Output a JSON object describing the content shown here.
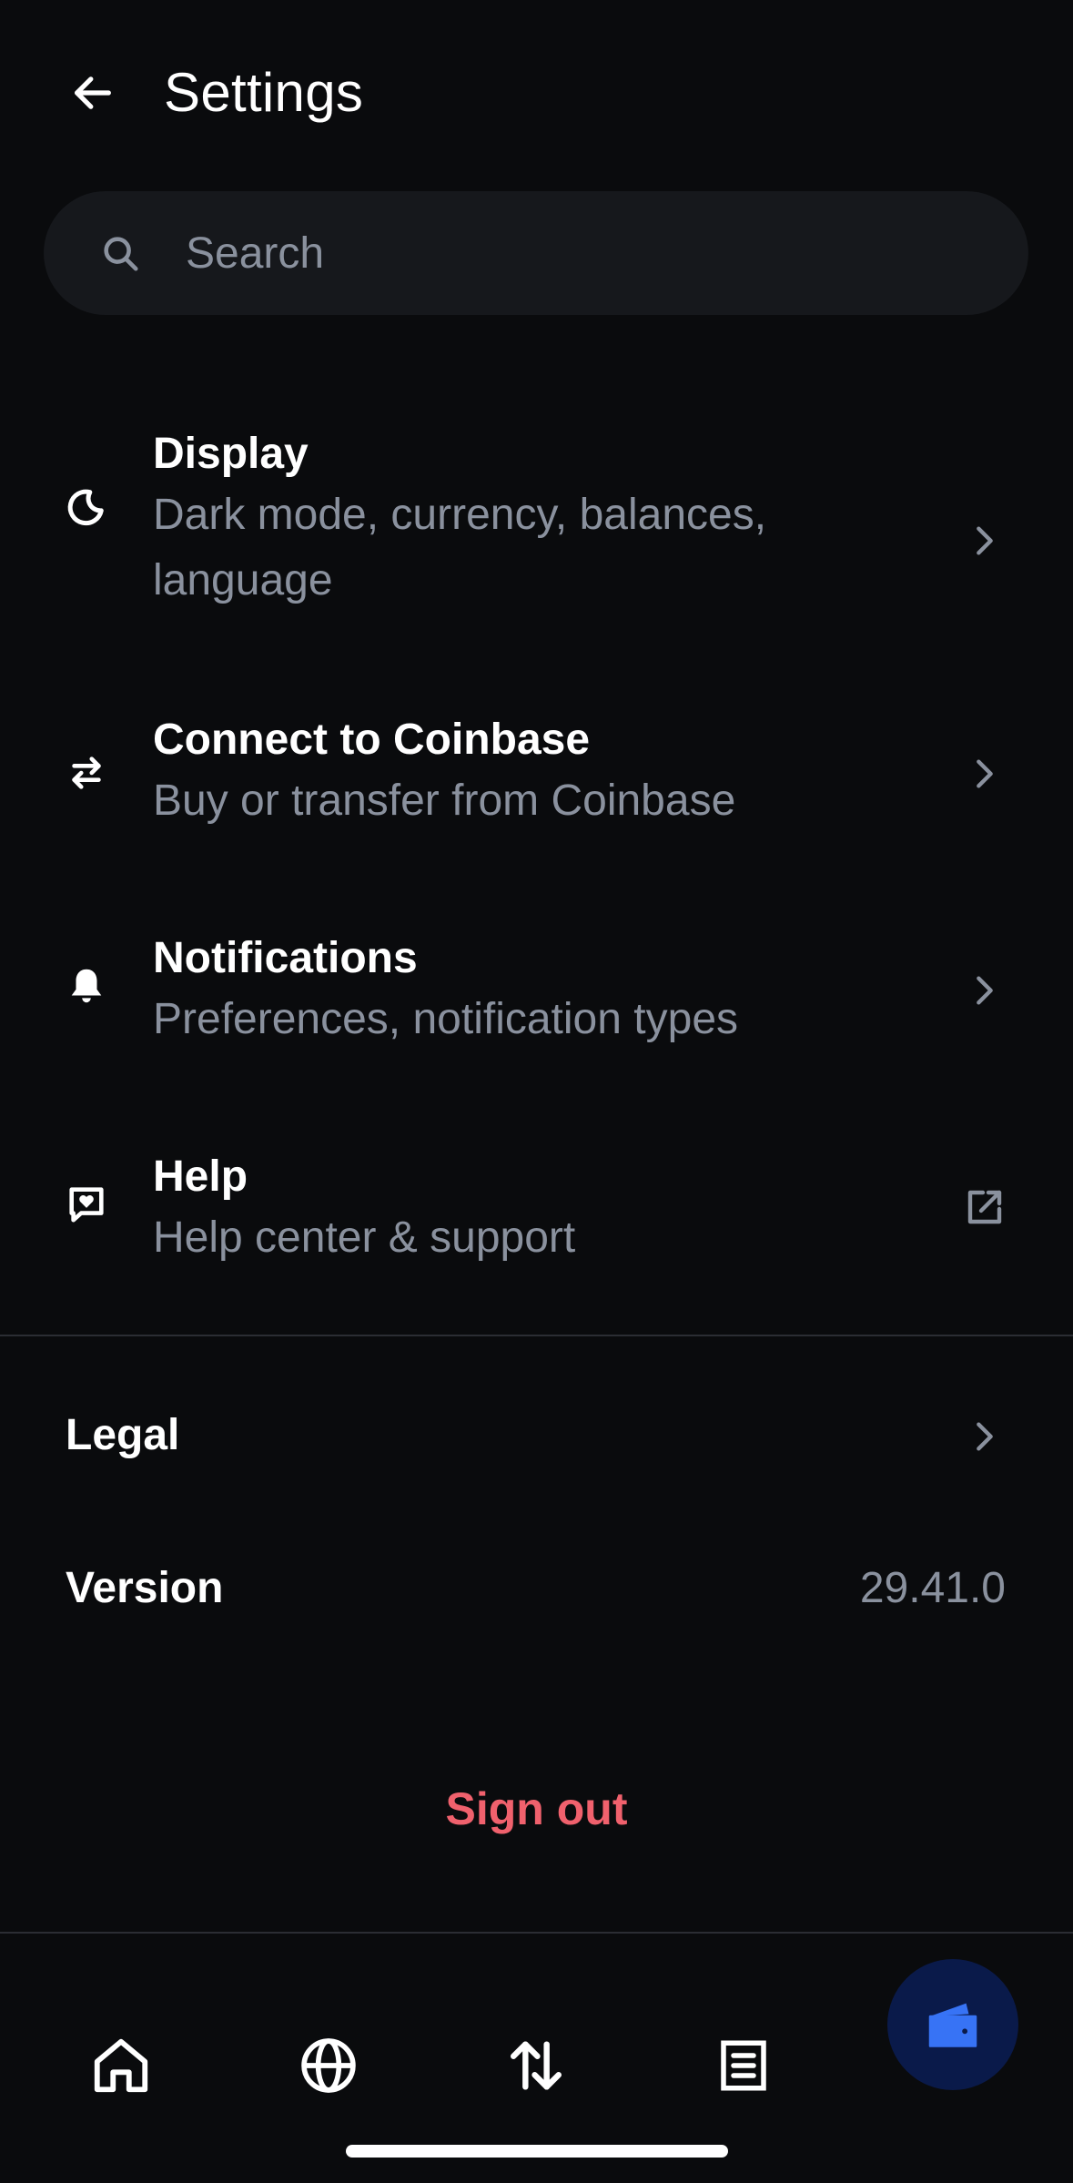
{
  "header": {
    "title": "Settings",
    "back_icon": "arrow-left-icon"
  },
  "search": {
    "placeholder": "Search",
    "value": "",
    "icon": "search-icon"
  },
  "settings": [
    {
      "icon": "moon-icon",
      "title": "Display",
      "subtitle_line1": "Dark mode, currency, balances,",
      "subtitle_line2": "language",
      "trail_icon": "chevron-right-icon"
    },
    {
      "icon": "transfer-arrows-icon",
      "title": "Connect to Coinbase",
      "subtitle_line1": "Buy or transfer from Coinbase",
      "trail_icon": "chevron-right-icon"
    },
    {
      "icon": "bell-icon",
      "title": "Notifications",
      "subtitle_line1": "Preferences, notification types",
      "trail_icon": "chevron-right-icon"
    },
    {
      "icon": "chat-heart-icon",
      "title": "Help",
      "subtitle_line1": "Help center & support",
      "trail_icon": "external-link-icon"
    }
  ],
  "legal": {
    "label": "Legal",
    "trail_icon": "chevron-right-icon"
  },
  "version": {
    "label": "Version",
    "value": "29.41.0"
  },
  "sign_out": {
    "label": "Sign out",
    "color": "#f0616d"
  },
  "bottom_nav": {
    "items": [
      {
        "icon": "home-icon"
      },
      {
        "icon": "globe-icon"
      },
      {
        "icon": "swap-arrows-icon"
      },
      {
        "icon": "document-icon"
      },
      {
        "icon": "wallet-icon",
        "active": true
      }
    ],
    "active_color": "#3773f5"
  },
  "colors": {
    "background": "#0a0b0d",
    "surface": "#16181c",
    "text_primary": "#ffffff",
    "text_secondary": "#8a919e",
    "divider": "#2b2d33"
  }
}
